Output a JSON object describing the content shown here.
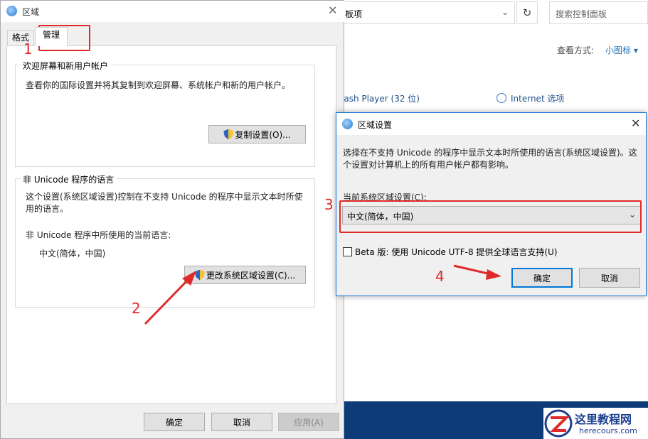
{
  "background": {
    "address_text": "板项",
    "search_placeholder": "搜索控制面板",
    "view_by_label": "查看方式:",
    "view_by_value": "小图标 ▾",
    "item_flash": "lash Player (32 位)",
    "item_internet": "Internet 选项",
    "refresh_glyph": "↻",
    "chevron_glyph": "⌄"
  },
  "region_dialog": {
    "title": "区域",
    "close_glyph": "✕",
    "tabs": [
      {
        "label": "格式",
        "selected": false
      },
      {
        "label": "管理",
        "selected": true
      }
    ],
    "welcome_group": {
      "title": "欢迎屏幕和新用户帐户",
      "description": "查看你的国际设置并将其复制到欢迎屏幕、系统帐户和新的用户帐户。",
      "copy_button": "复制设置(O)..."
    },
    "unicode_group": {
      "title": "非 Unicode 程序的语言",
      "description": "这个设置(系统区域设置)控制在不支持 Unicode 的程序中显示文本时所使用的语言。",
      "current_label": "非 Unicode 程序中所使用的当前语言:",
      "current_value": "中文(简体，中国)",
      "change_button": "更改系统区域设置(C)..."
    },
    "buttons": {
      "ok": "确定",
      "cancel": "取消",
      "apply": "应用(A)"
    }
  },
  "locale_dialog": {
    "title": "区域设置",
    "close_glyph": "✕",
    "description": "选择在不支持 Unicode 的程序中显示文本时所使用的语言(系统区域设置)。这个设置对计算机上的所有用户帐户都有影响。",
    "select_label": "当前系统区域设置(C):",
    "select_value": "中文(简体，中国)",
    "select_chevron": "⌄",
    "beta_label": "Beta 版: 使用 Unicode UTF-8 提供全球语言支持(U)",
    "beta_checked": false,
    "ok": "确定",
    "cancel": "取消"
  },
  "annotations": {
    "step1": "1",
    "step2": "2",
    "step3": "3",
    "step4": "4",
    "color": "#e02a2a"
  },
  "watermark": {
    "line1": "这里教程网",
    "line2": "herecours.com"
  }
}
